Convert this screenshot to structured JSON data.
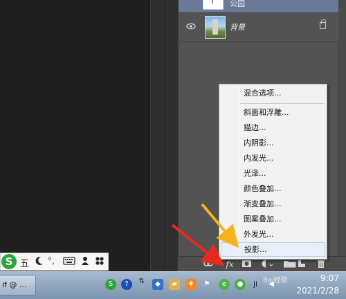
{
  "layers": {
    "selected_layer_name": "公园",
    "background_layer_name": "背景"
  },
  "context_menu": {
    "items": [
      "混合选项...",
      "斜面和浮雕...",
      "描边...",
      "内阴影...",
      "内发光...",
      "光泽...",
      "颜色叠加...",
      "渐变叠加...",
      "图案叠加...",
      "外发光...",
      "投影..."
    ],
    "highlighted_item": "投影..."
  },
  "panel_toolbar": {
    "link_icon": "link-icon",
    "fx_label": "fx",
    "mask_icon": "mask-icon",
    "adjustment_icon": "adjustment-icon",
    "folder_icon": "folder-icon",
    "new_layer_icon": "new-layer-icon",
    "trash_icon": "trash-icon"
  },
  "ime_bar": {
    "logo": "S",
    "mode": "五",
    "icons": [
      "moon-icon",
      "punctuation-icon",
      "keyboard-icon",
      "user-icon",
      "grid-icon"
    ]
  },
  "taskbar": {
    "task_button_label": "if @ ...",
    "tray_icons": [
      "sogou-icon",
      "help-icon",
      "network-icon",
      "cube-icon",
      "folder-icon",
      "shield-icon",
      "flag-icon",
      "green-circle-icon",
      "wechat-icon",
      "speaker-icon"
    ],
    "tray_text": "ji",
    "clock_time": "9:07",
    "clock_date": "2021/2/28",
    "watermark": "Bai经验"
  },
  "colors": {
    "selection_blue": "#6b7a96",
    "annotation_red": "#e8291f",
    "annotation_yellow": "#f5b51a"
  }
}
